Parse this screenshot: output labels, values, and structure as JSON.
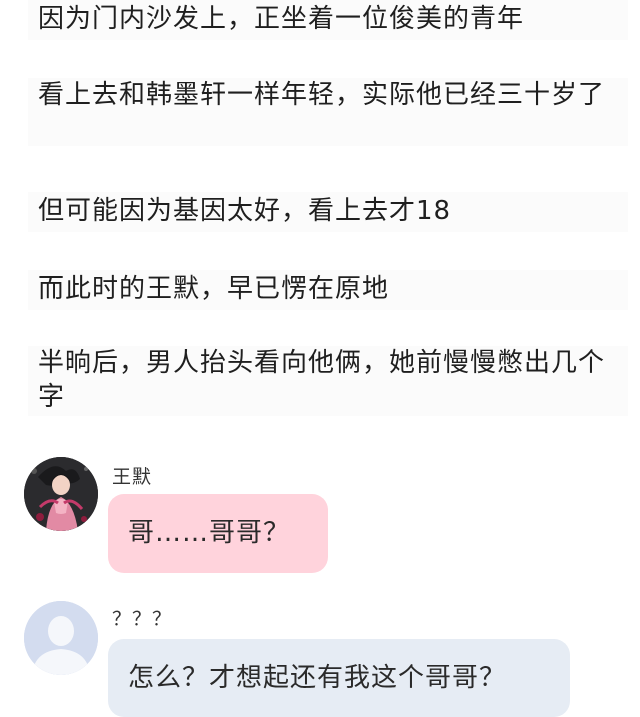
{
  "narration": [
    "因为门内沙发上，正坐着一位俊美的青年",
    "看上去和韩墨轩一样年轻，实际他已经三十岁了",
    "但可能因为基因太好，看上去才18",
    "而此时的王默，早已愣在原地",
    "半晌后，男人抬头看向他俩，她前慢慢憋出几个字"
  ],
  "messages": [
    {
      "sender": "王默",
      "text": "哥……哥哥？",
      "avatar": "character-avatar",
      "bubble_color": "#ffd3dc"
    },
    {
      "sender": "？？？",
      "text": "怎么？才想起还有我这个哥哥？",
      "avatar": "default-user-avatar",
      "bubble_color": "#e6ecf4"
    }
  ]
}
